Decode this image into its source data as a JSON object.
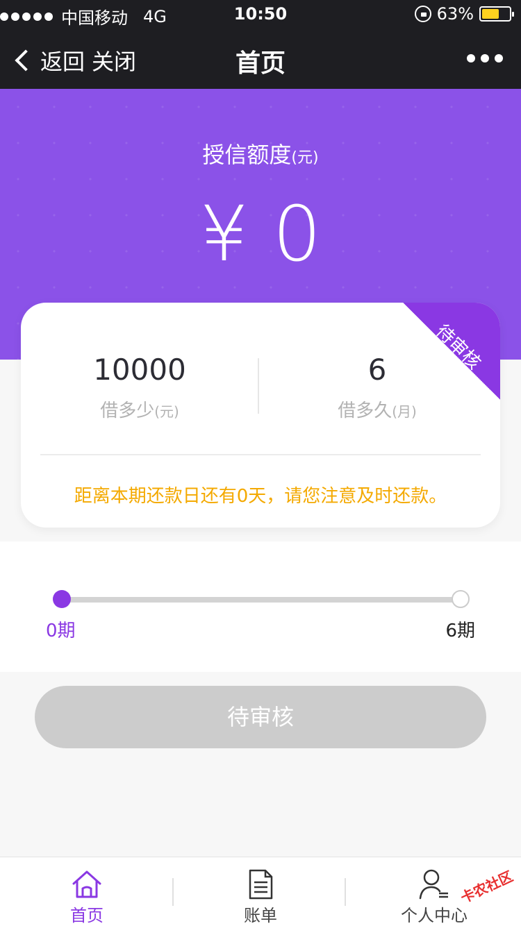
{
  "statusbar": {
    "carrier": "中国移动",
    "network": "4G",
    "time": "10:50",
    "battery_text": "63%",
    "battery_level": 0.63
  },
  "navbar": {
    "back_label": "返回",
    "close_label": "关闭",
    "title": "首页"
  },
  "hero": {
    "label": "授信额度",
    "label_unit": "(元)",
    "amount": "¥ 0"
  },
  "card": {
    "ribbon": "待审核",
    "amount_value": "10000",
    "amount_label": "借多少",
    "amount_unit": "(元)",
    "term_value": "6",
    "term_label": "借多久",
    "term_unit": "(月)",
    "notice": "距离本期还款日还有0天，请您注意及时还款。"
  },
  "progress": {
    "current": 0,
    "total": 6,
    "min_label": "0期",
    "max_label": "6期"
  },
  "action": {
    "button_label": "待审核"
  },
  "tabbar": {
    "items": [
      {
        "label": "首页",
        "icon": "home-icon",
        "active": true
      },
      {
        "label": "账单",
        "icon": "bill-icon",
        "active": false
      },
      {
        "label": "个人中心",
        "icon": "user-icon",
        "active": false
      }
    ]
  },
  "watermark": "卡农社区",
  "colors": {
    "accent": "#8a38e3",
    "hero": "#8b52e8",
    "notice": "#f4a900",
    "button_disabled": "#cccccc"
  }
}
